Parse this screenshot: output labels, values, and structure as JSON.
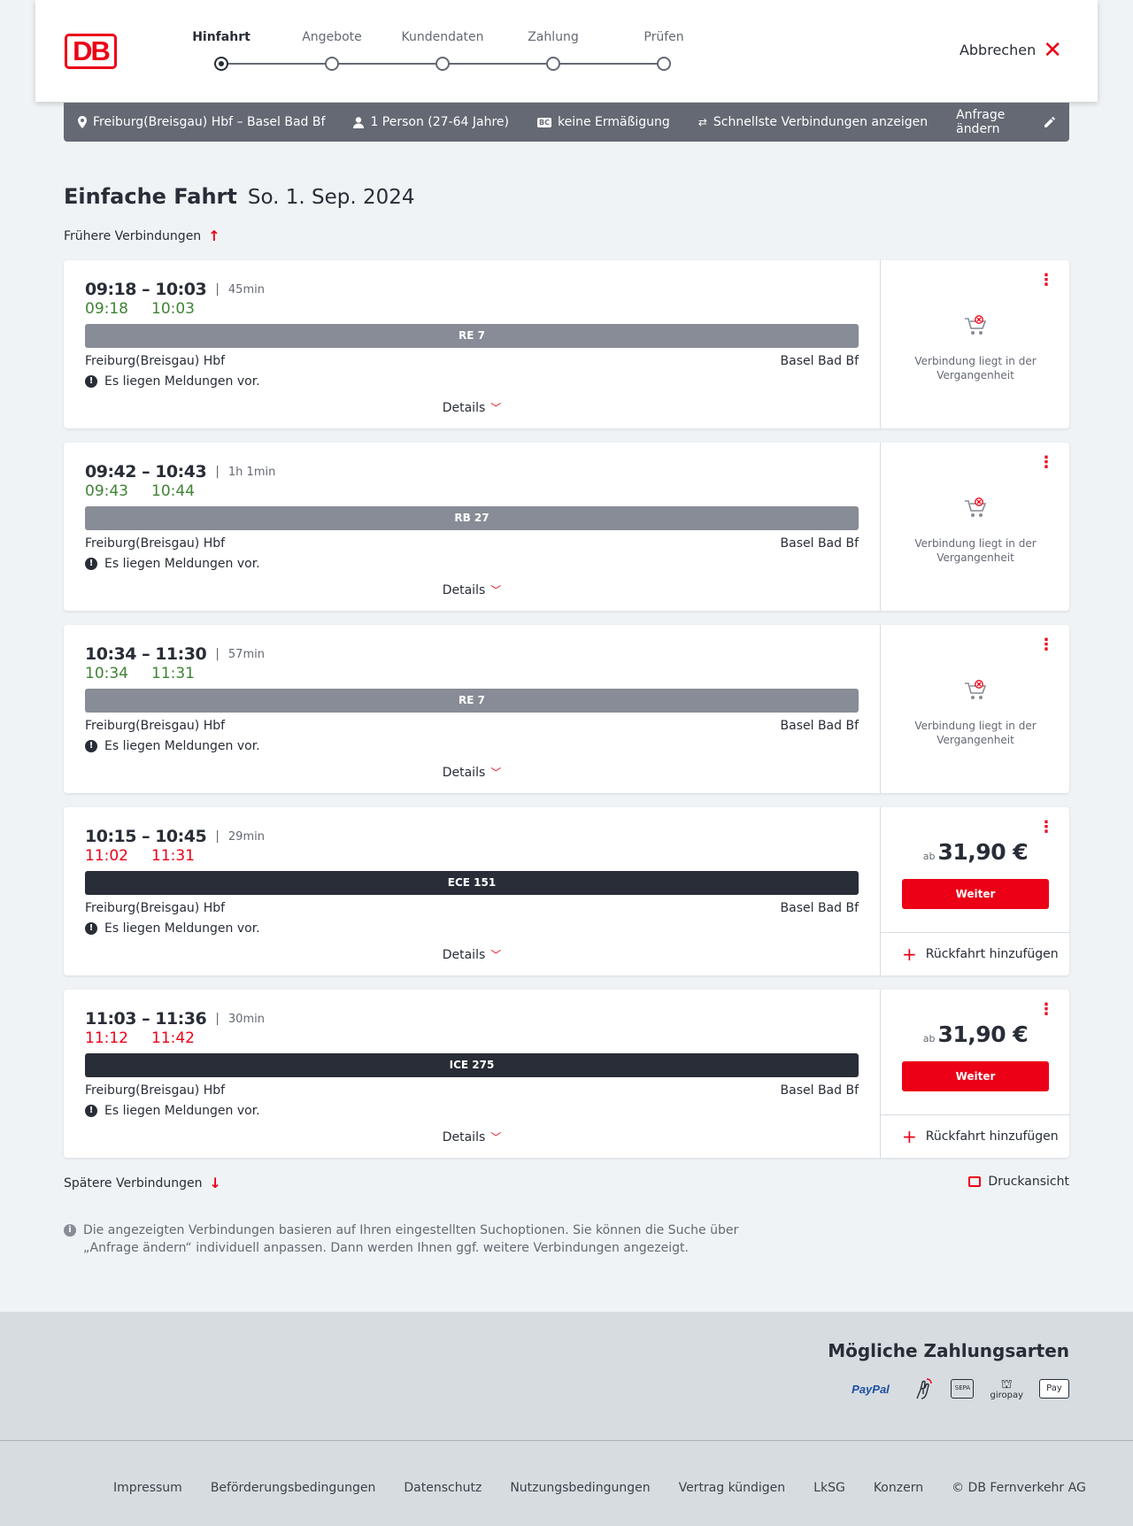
{
  "header": {
    "steps": [
      "Hinfahrt",
      "Angebote",
      "Kundendaten",
      "Zahlung",
      "Prüfen"
    ],
    "logo_text": "DB",
    "cancel_label": "Abbrechen"
  },
  "summary": {
    "route": "Freiburg(Breisgau) Hbf – Basel Bad Bf",
    "passengers": "1 Person (27-64 Jahre)",
    "discount_badge": "BC",
    "discount": "keine Ermäßigung",
    "fastest": "Schnellste Verbindungen anzeigen",
    "edit": "Anfrage ändern"
  },
  "title": {
    "strong": "Einfache Fahrt",
    "date": "So. 1. Sep. 2024"
  },
  "earlier_label": "Frühere Verbindungen",
  "later_label": "Spätere Verbindungen",
  "print_label": "Druckansicht",
  "connections": [
    {
      "times": "09:18 – 10:03",
      "duration": "45min",
      "rt_dep": "09:18",
      "rt_arr": "10:03",
      "train": "RE 7",
      "from": "Freiburg(Breisgau) Hbf",
      "to": "Basel Bad Bf",
      "message": "Es liegen Meldungen vor.",
      "details": "Details",
      "past_text": "Verbindung liegt in der Vergangenheit"
    },
    {
      "times": "09:42 – 10:43",
      "duration": "1h 1min",
      "rt_dep": "09:43",
      "rt_arr": "10:44",
      "train": "RB 27",
      "from": "Freiburg(Breisgau) Hbf",
      "to": "Basel Bad Bf",
      "message": "Es liegen Meldungen vor.",
      "details": "Details",
      "past_text": "Verbindung liegt in der Vergangenheit"
    },
    {
      "times": "10:34 – 11:30",
      "duration": "57min",
      "rt_dep": "10:34",
      "rt_arr": "11:31",
      "train": "RE 7",
      "from": "Freiburg(Breisgau) Hbf",
      "to": "Basel Bad Bf",
      "message": "Es liegen Meldungen vor.",
      "details": "Details",
      "past_text": "Verbindung liegt in der Vergangenheit"
    },
    {
      "times": "10:15 – 10:45",
      "duration": "29min",
      "rt_dep": "11:02",
      "rt_arr": "11:31",
      "train": "ECE 151",
      "from": "Freiburg(Breisgau) Hbf",
      "to": "Basel Bad Bf",
      "message": "Es liegen Meldungen vor.",
      "details": "Details",
      "price_prefix": "ab",
      "price": "31,90 €",
      "cta": "Weiter",
      "return_label": "Rückfahrt hinzufügen"
    },
    {
      "times": "11:03 – 11:36",
      "duration": "30min",
      "rt_dep": "11:12",
      "rt_arr": "11:42",
      "train": "ICE 275",
      "from": "Freiburg(Breisgau) Hbf",
      "to": "Basel Bad Bf",
      "message": "Es liegen Meldungen vor.",
      "details": "Details",
      "price_prefix": "ab",
      "price": "31,90 €",
      "cta": "Weiter",
      "return_label": "Rückfahrt hinzufügen"
    }
  ],
  "info_text": "Die angezeigten Verbindungen basieren auf Ihren eingestellten Suchoptionen. Sie können die Suche über „Anfrage ändern“ individuell anpassen. Dann werden Ihnen ggf. weitere Verbindungen angezeigt.",
  "payments": {
    "title": "Mögliche Zahlungsarten",
    "paypal": "PayPal",
    "sepa": "SEPA",
    "giropay": "giropay",
    "applepay": "Pay"
  },
  "footer_links": [
    "Impressum",
    "Beförderungsbedingungen",
    "Datenschutz",
    "Nutzungsbedingungen",
    "Vertrag kündigen",
    "LkSG",
    "Konzern",
    "© DB Fernverkehr AG"
  ],
  "colors": {
    "db_red": "#ec0016",
    "on_time_green": "#408335",
    "dark": "#282d37",
    "grey": "#646973"
  }
}
